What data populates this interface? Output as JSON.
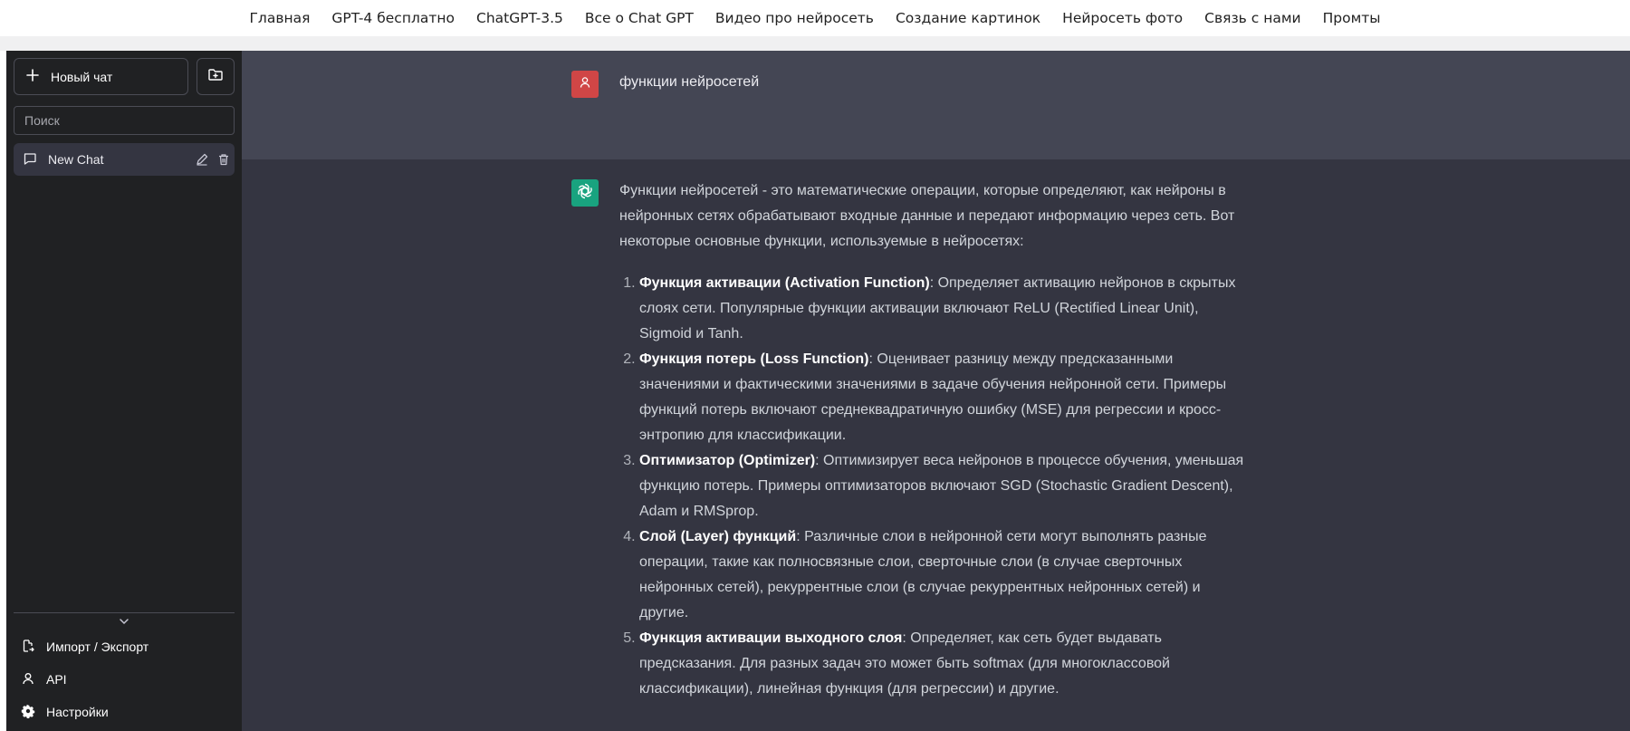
{
  "nav": {
    "links": [
      "Главная",
      "GPT-4 бесплатно",
      "ChatGPT-3.5",
      "Все о Chat GPT",
      "Видео про нейросеть",
      "Создание картинок",
      "Нейросеть фото",
      "Связь с нами",
      "Промты"
    ]
  },
  "sidebar": {
    "new_chat_label": "Новый чат",
    "search_placeholder": "Поиск",
    "chats": [
      {
        "label": "New Chat"
      }
    ],
    "bottom": {
      "import_export": "Импорт / Экспорт",
      "api": "API",
      "settings": "Настройки"
    }
  },
  "conversation": {
    "user_message": "функции нейросетей",
    "answer_intro": "Функции нейросетей - это математические операции, которые определяют, как нейроны в нейронных сетях обрабатывают входные данные и передают информацию через сеть. Вот некоторые основные функции, используемые в нейросетях:",
    "items": [
      {
        "title": "Функция активации (Activation Function)",
        "text": ": Определяет активацию нейронов в скрытых слоях сети. Популярные функции активации включают ReLU (Rectified Linear Unit), Sigmoid и Tanh."
      },
      {
        "title": "Функция потерь (Loss Function)",
        "text": ": Оценивает разницу между предсказанными значениями и фактическими значениями в задаче обучения нейронной сети. Примеры функций потерь включают среднеквадратичную ошибку (MSE) для регрессии и кросс-энтропию для классификации."
      },
      {
        "title": "Оптимизатор (Optimizer)",
        "text": ": Оптимизирует веса нейронов в процессе обучения, уменьшая функцию потерь. Примеры оптимизаторов включают SGD (Stochastic Gradient Descent), Adam и RMSprop."
      },
      {
        "title": "Слой (Layer) функций",
        "text": ": Различные слои в нейронной сети могут выполнять разные операции, такие как полносвязные слои, сверточные слои (в случае сверточных нейронных сетей), рекуррентные слои (в случае рекуррентных нейронных сетей) и другие."
      },
      {
        "title": "Функция активации выходного слоя",
        "text": ": Определяет, как сеть будет выдавать предсказания. Для разных задач это может быть softmax (для многоклассовой классификации), линейная функция (для регрессии) и другие."
      }
    ]
  },
  "colors": {
    "sidebar_bg": "#202123",
    "user_row_bg": "#444654",
    "assistant_row_bg": "#343541",
    "user_avatar": "#d04646",
    "gpt_avatar": "#19a37f"
  },
  "icons": {
    "new_chat": "plus-icon",
    "new_folder": "folder-plus-icon",
    "chat": "message-square-icon",
    "edit": "pencil-icon",
    "delete": "trash-icon",
    "collapse": "chevron-down-icon",
    "import_export": "file-export-icon",
    "api": "user-icon",
    "settings": "gear-icon",
    "user_avatar": "user-icon",
    "gpt_avatar": "openai-logo-icon"
  }
}
